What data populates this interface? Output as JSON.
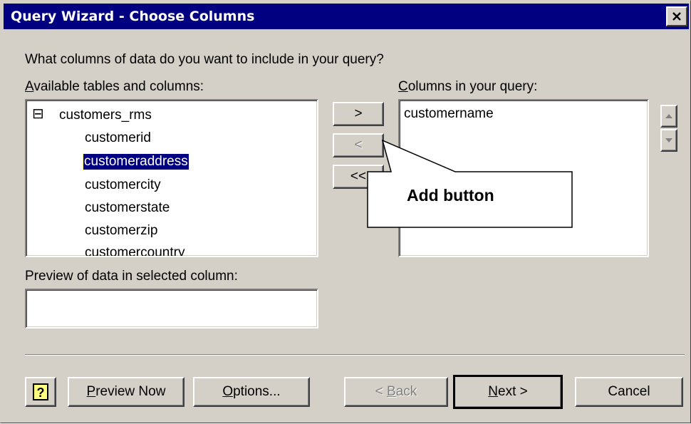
{
  "window": {
    "title": "Query Wizard - Choose Columns"
  },
  "prompt": "What columns of data do you want to include in your query?",
  "available": {
    "label_key": "A",
    "label_rest": "vailable tables and columns:",
    "table_name": "customers_rms",
    "expander": "⊟",
    "columns": [
      "customerid",
      "customeraddress",
      "customercity",
      "customerstate",
      "customerzip",
      "customercountry"
    ],
    "selected": "customeraddress"
  },
  "query_columns": {
    "label_key": "C",
    "label_rest": "olumns in your query:",
    "items": [
      "customername"
    ]
  },
  "transfer_buttons": {
    "add": ">",
    "remove": "<",
    "remove_all": "<<"
  },
  "preview": {
    "label": "Preview of data in selected column:",
    "value": ""
  },
  "callout": {
    "text": "Add button"
  },
  "buttons": {
    "help": "?",
    "preview_key": "P",
    "preview_rest": "review Now",
    "options_key": "O",
    "options_rest": "ptions...",
    "back_prefix": "< ",
    "back_key": "B",
    "back_rest": "ack",
    "next_key": "N",
    "next_rest": "ext >",
    "cancel": "Cancel"
  },
  "icons": {
    "close": "close-icon",
    "scroll_up": "scroll-up-arrow-icon",
    "scroll_down": "scroll-down-arrow-icon",
    "move_up": "move-up-arrow-icon",
    "move_down": "move-down-arrow-icon",
    "help": "help-question-icon"
  }
}
